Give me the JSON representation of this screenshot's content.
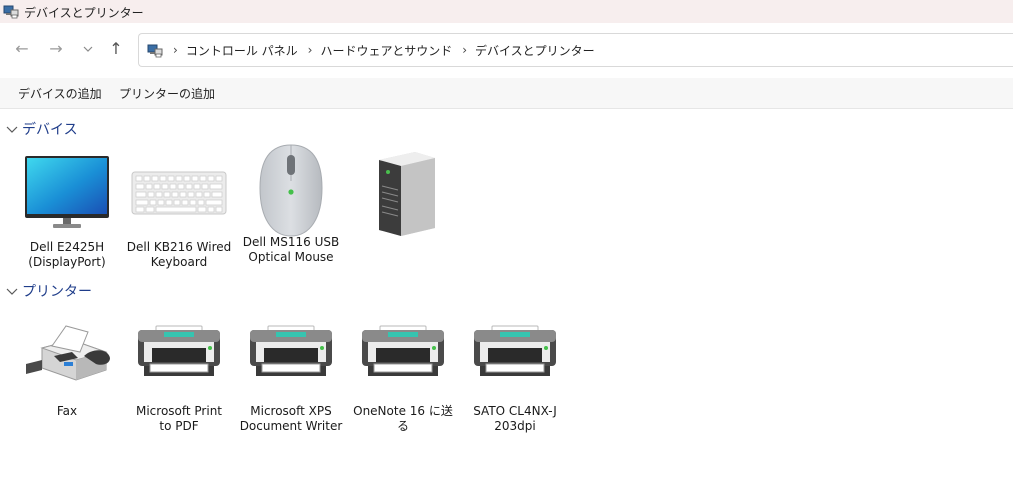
{
  "window": {
    "title": "デバイスとプリンター"
  },
  "nav": {
    "back_label": "←",
    "forward_label": "→",
    "recent_label": "⌄",
    "up_label": "↑"
  },
  "address": {
    "crumbs": [
      "コントロール パネル",
      "ハードウェアとサウンド",
      "デバイスとプリンター"
    ],
    "separator": "›"
  },
  "commands": {
    "add_device": "デバイスの追加",
    "add_printer": "プリンターの追加"
  },
  "groups": {
    "devices": {
      "title": "デバイス",
      "items": [
        {
          "label": "Dell E2425H\n(DisplayPort)",
          "icon": "monitor-icon"
        },
        {
          "label": "Dell KB216 Wired\nKeyboard",
          "icon": "keyboard-icon"
        },
        {
          "label": "Dell MS116 USB\nOptical Mouse",
          "icon": "mouse-icon"
        },
        {
          "label": "",
          "icon": "computer-tower-icon"
        }
      ]
    },
    "printers": {
      "title": "プリンター",
      "items": [
        {
          "label": "Fax",
          "icon": "fax-icon"
        },
        {
          "label": "Microsoft Print\nto PDF",
          "icon": "printer-icon"
        },
        {
          "label": "Microsoft XPS\nDocument Writer",
          "icon": "printer-icon"
        },
        {
          "label": "OneNote 16 に送\nる",
          "icon": "printer-icon"
        },
        {
          "label": "SATO CL4NX-J\n203dpi",
          "icon": "printer-icon"
        }
      ]
    }
  },
  "colors": {
    "group_header": "#1f3d8a",
    "titlebar_bg": "#f7eeee",
    "command_bar_bg": "#f7f7f7"
  }
}
